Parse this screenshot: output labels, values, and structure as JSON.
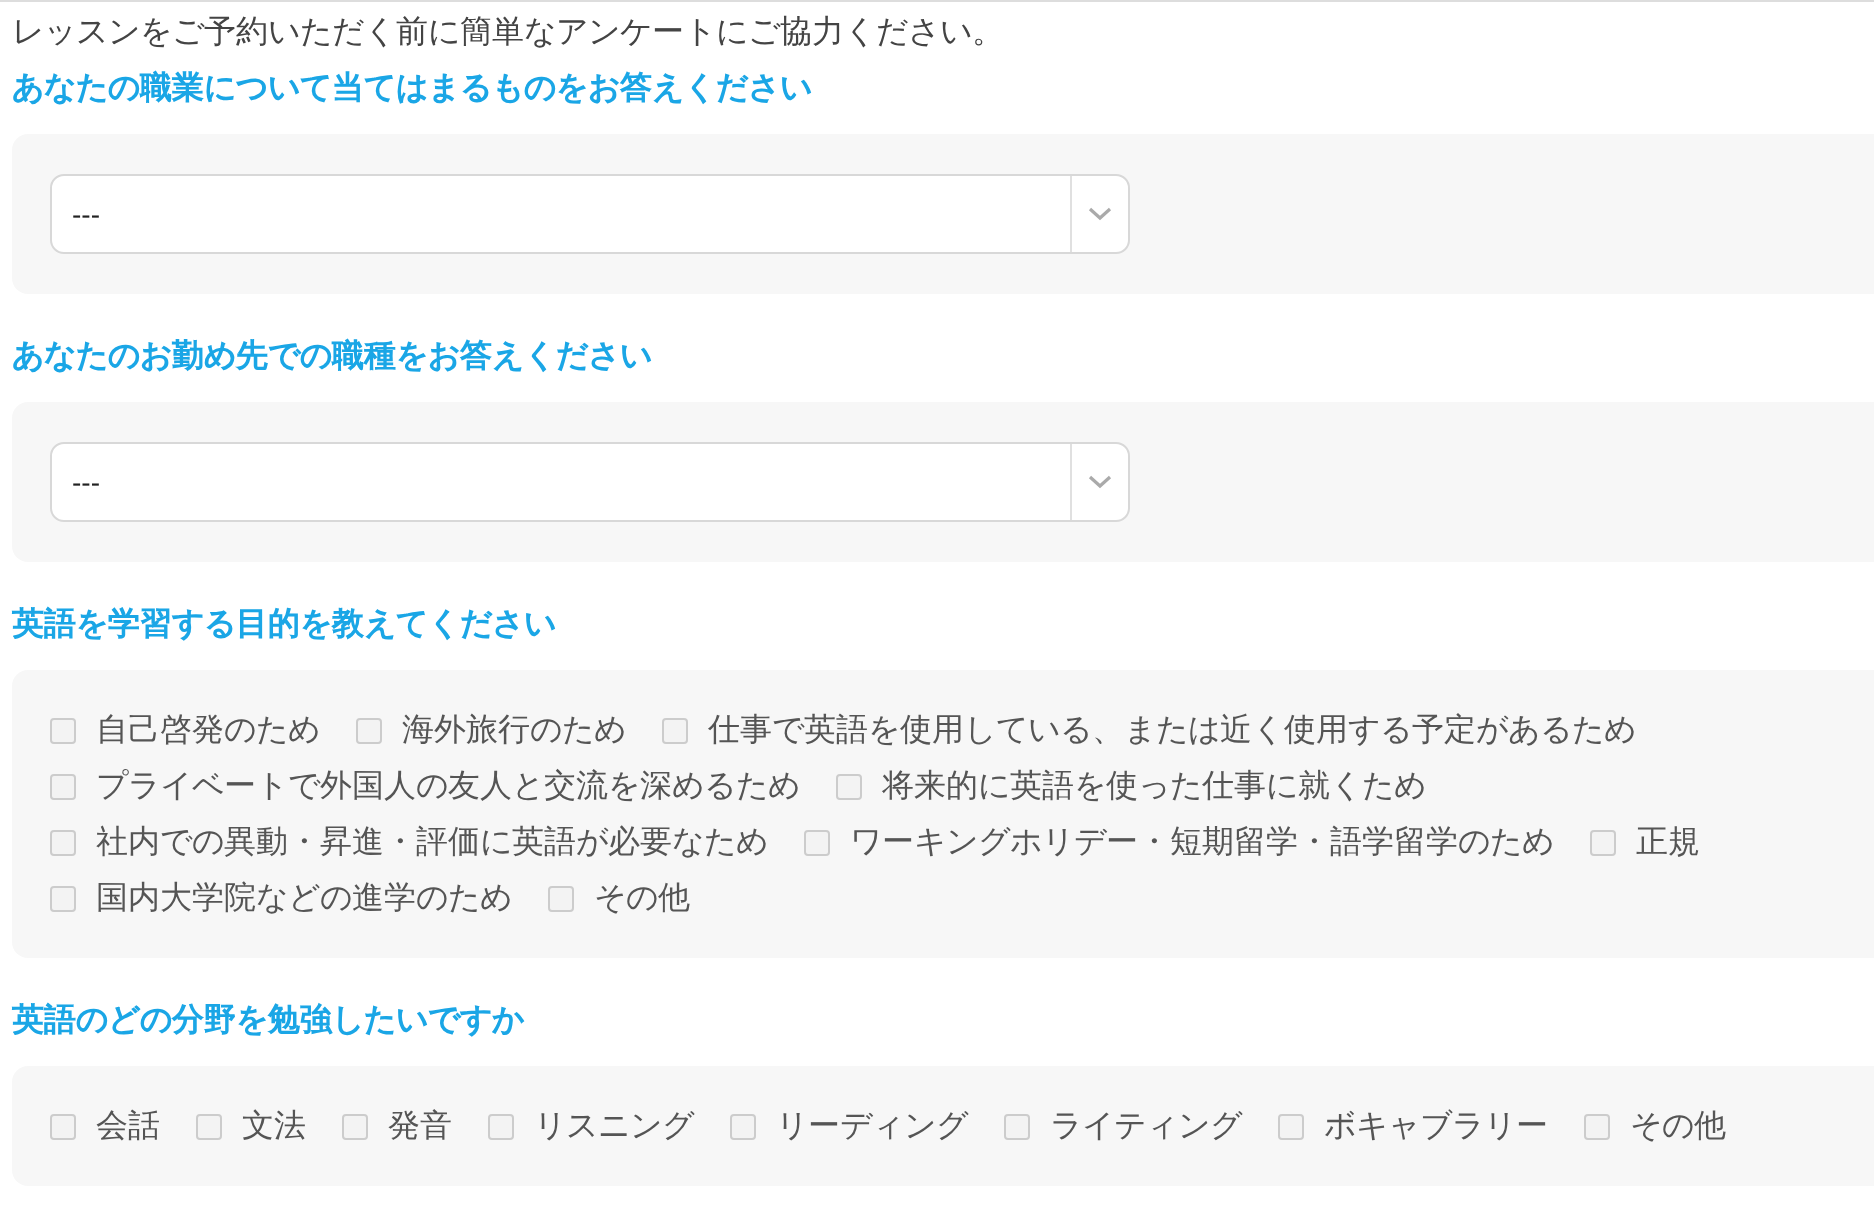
{
  "intro": "レッスンをご予約いただく前に簡単なアンケートにご協力ください。",
  "questions": [
    {
      "kind": "select",
      "title": "あなたの職業について当てはまるものをお答えください",
      "value": "---"
    },
    {
      "kind": "select",
      "title": "あなたのお勤め先での職種をお答えください",
      "value": "---"
    },
    {
      "kind": "checkboxes",
      "title": "英語を学習する目的を教えてください",
      "options": [
        {
          "label": "自己啓発のため",
          "checked": false
        },
        {
          "label": "海外旅行のため",
          "checked": false
        },
        {
          "label": "仕事で英語を使用している、または近く使用する予定があるため",
          "checked": false
        },
        {
          "label": "プライベートで外国人の友人と交流を深めるため",
          "checked": false
        },
        {
          "label": "将来的に英語を使った仕事に就くため",
          "checked": false
        },
        {
          "label": "社内での異動・昇進・評価に英語が必要なため",
          "checked": false
        },
        {
          "label": "ワーキングホリデー・短期留学・語学留学のため",
          "checked": false
        },
        {
          "label": "正規",
          "checked": false
        },
        {
          "label": "国内大学院などの進学のため",
          "checked": false
        },
        {
          "label": "その他",
          "checked": false
        }
      ]
    },
    {
      "kind": "checkboxes",
      "title": "英語のどの分野を勉強したいですか",
      "options": [
        {
          "label": "会話",
          "checked": false
        },
        {
          "label": "文法",
          "checked": false
        },
        {
          "label": "発音",
          "checked": false
        },
        {
          "label": "リスニング",
          "checked": false
        },
        {
          "label": "リーディング",
          "checked": false
        },
        {
          "label": "ライティング",
          "checked": false
        },
        {
          "label": "ボキャブラリー",
          "checked": false
        },
        {
          "label": "その他",
          "checked": false
        }
      ]
    }
  ]
}
